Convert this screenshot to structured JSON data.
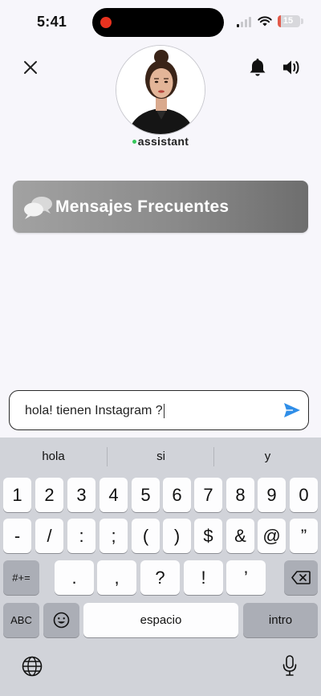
{
  "status_bar": {
    "time": "5:41",
    "battery_level": "15",
    "battery_fraction": 0.15,
    "recording": true
  },
  "header": {
    "close_icon": "close-icon",
    "bell_icon": "bell-icon",
    "speaker_icon": "speaker-icon",
    "assistant_name": "assistant",
    "online_color": "#34c759"
  },
  "frequent_messages": {
    "icon": "chat-bubbles-icon",
    "label": "Mensajes Frecuentes"
  },
  "message_input": {
    "value": "hola! tienen Instagram ?",
    "send_icon": "send-icon",
    "send_color": "#2f8ee8"
  },
  "keyboard": {
    "suggestions": [
      "hola",
      "si",
      "y"
    ],
    "row1": [
      "1",
      "2",
      "3",
      "4",
      "5",
      "6",
      "7",
      "8",
      "9",
      "0"
    ],
    "row2": [
      "-",
      "/",
      ":",
      ";",
      "(",
      ")",
      "$",
      "&",
      "@",
      "”"
    ],
    "row3_left": "#+=",
    "row3": [
      ".",
      ",",
      "?",
      "!",
      "’"
    ],
    "row3_right_icon": "backspace-icon",
    "abc_label": "ABC",
    "emoji_icon": "emoji-icon",
    "space_label": "espacio",
    "return_label": "intro",
    "globe_icon": "globe-icon",
    "mic_icon": "microphone-icon"
  }
}
